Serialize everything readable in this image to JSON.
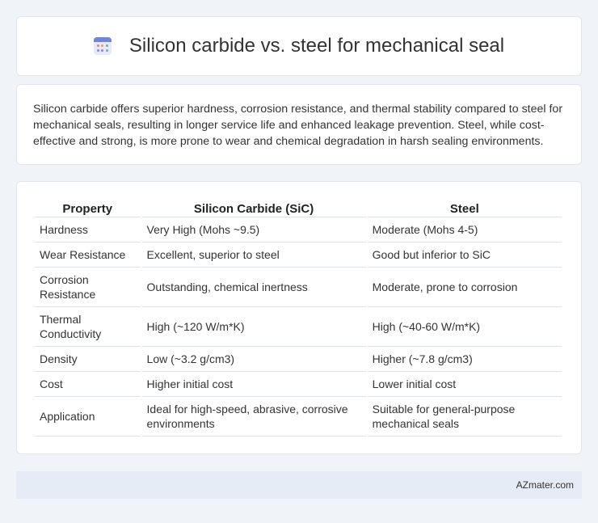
{
  "header": {
    "title": "Silicon carbide vs. steel for mechanical seal",
    "icon": "calendar-grid-icon"
  },
  "description": "Silicon carbide offers superior hardness, corrosion resistance, and thermal stability compared to steel for mechanical seals, resulting in longer service life and enhanced leakage prevention. Steel, while cost-effective and strong, is more prone to wear and chemical degradation in harsh sealing environments.",
  "table": {
    "headers": [
      "Property",
      "Silicon Carbide (SiC)",
      "Steel"
    ],
    "rows": [
      [
        "Hardness",
        "Very High (Mohs ~9.5)",
        "Moderate (Mohs 4-5)"
      ],
      [
        "Wear Resistance",
        "Excellent, superior to steel",
        "Good but inferior to SiC"
      ],
      [
        "Corrosion Resistance",
        "Outstanding, chemical inertness",
        "Moderate, prone to corrosion"
      ],
      [
        "Thermal Conductivity",
        "High (~120 W/m*K)",
        "High (~40-60 W/m*K)"
      ],
      [
        "Density",
        "Low (~3.2 g/cm3)",
        "Higher (~7.8 g/cm3)"
      ],
      [
        "Cost",
        "Higher initial cost",
        "Lower initial cost"
      ],
      [
        "Application",
        "Ideal for high-speed, abrasive, corrosive environments",
        "Suitable for general-purpose mechanical seals"
      ]
    ]
  },
  "footer": {
    "brand": "AZmater.com"
  },
  "colors": {
    "background": "#f0f3f8",
    "card": "#ffffff",
    "footer": "#e6ecf6",
    "icon_accent": "#6f86d6"
  }
}
